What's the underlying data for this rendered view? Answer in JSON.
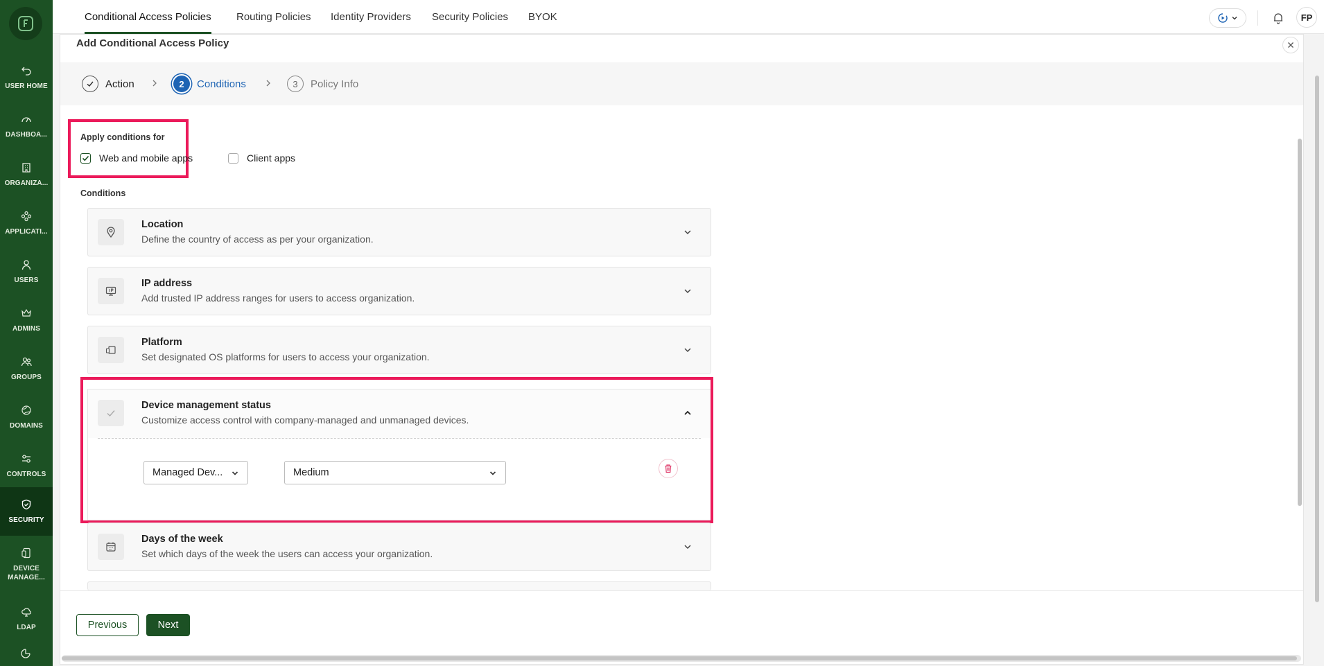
{
  "sidebar": {
    "items": [
      {
        "label": "USER HOME",
        "icon": "undo-arrow-icon"
      },
      {
        "label": "DASHBOA...",
        "icon": "gauge-icon"
      },
      {
        "label": "ORGANIZA...",
        "icon": "building-icon"
      },
      {
        "label": "APPLICATI...",
        "icon": "apps-icon"
      },
      {
        "label": "USERS",
        "icon": "user-icon"
      },
      {
        "label": "ADMINS",
        "icon": "crown-icon"
      },
      {
        "label": "GROUPS",
        "icon": "group-icon"
      },
      {
        "label": "DOMAINS",
        "icon": "globe-icon"
      },
      {
        "label": "CONTROLS",
        "icon": "sliders-icon"
      },
      {
        "label": "SECURITY",
        "icon": "shield-icon"
      },
      {
        "label": "DEVICE\nMANAGE...",
        "icon": "device-icon"
      },
      {
        "label": "LDAP",
        "icon": "cloud-icon"
      }
    ]
  },
  "topnav": {
    "tabs": [
      "Conditional Access Policies",
      "Routing Policies",
      "Identity Providers",
      "Security Policies",
      "BYOK"
    ],
    "active_tab": "Conditional Access Policies",
    "avatar_initials": "FP"
  },
  "panel": {
    "title": "Add Conditional Access Policy",
    "steps": [
      {
        "number": "1",
        "label": "Action",
        "state": "done"
      },
      {
        "number": "2",
        "label": "Conditions",
        "state": "active"
      },
      {
        "number": "3",
        "label": "Policy Info",
        "state": "pending"
      }
    ],
    "apply_label": "Apply conditions for",
    "apply_options": [
      {
        "label": "Web and mobile apps",
        "checked": true
      },
      {
        "label": "Client apps",
        "checked": false
      }
    ],
    "conditions_label": "Conditions",
    "conditions": [
      {
        "title": "Location",
        "desc": "Define the country of access as per your organization."
      },
      {
        "title": "IP address",
        "desc": "Add trusted IP address ranges for users to access organization."
      },
      {
        "title": "Platform",
        "desc": "Set designated OS platforms for users to access your organization."
      },
      {
        "title": "Device management status",
        "desc": "Customize access control with company-managed and unmanaged devices."
      },
      {
        "title": "Days of the week",
        "desc": "Set which days of the week the users can access your organization."
      }
    ],
    "device_status": {
      "type_value": "Managed Dev...",
      "level_value": "Medium"
    },
    "buttons": {
      "previous": "Previous",
      "next": "Next"
    }
  },
  "colors": {
    "brand_green": "#1c5124",
    "highlight": "#eb1a5a",
    "step_active": "#1e64b4"
  }
}
